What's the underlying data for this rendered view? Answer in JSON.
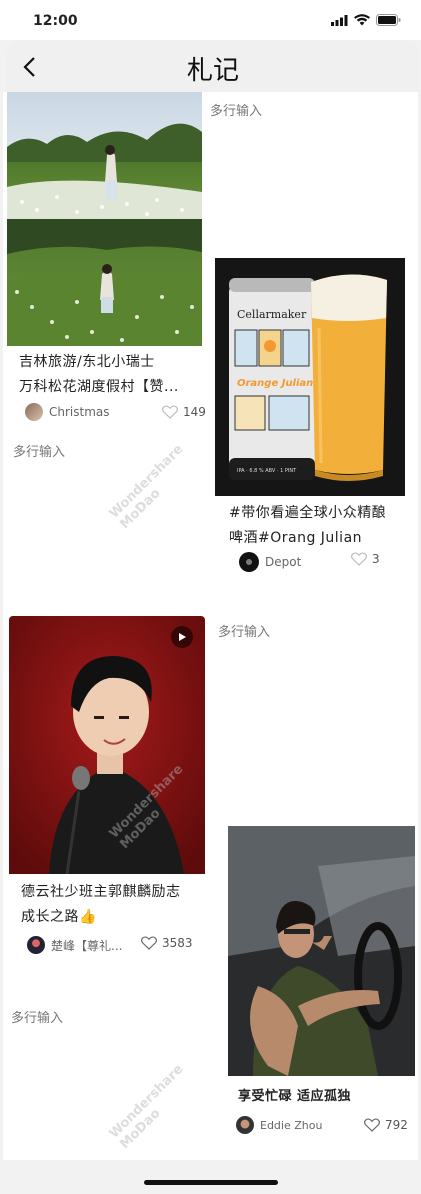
{
  "status": {
    "time": "12:00"
  },
  "nav": {
    "title": "札记"
  },
  "multi_labels": [
    "多行输入",
    "多行输入",
    "多行输入",
    "多行输入"
  ],
  "cards": [
    {
      "title_line1": "吉林旅游/东北小瑞士",
      "title_line2": "万科松花湖度假村【赞...",
      "author": "Christmas",
      "likes": "149"
    },
    {
      "title_line1": "#带你看遍全球小众精酿",
      "title_line2": "啤酒#Orang Julian",
      "author": "Depot",
      "likes": "3"
    },
    {
      "title_line1": "德云社少班主郭麒麟励志",
      "title_line2": "成长之路👍",
      "author": "楚峰【尊礼...",
      "likes": "3583"
    },
    {
      "title_line1": "享受忙碌 适应孤独",
      "author": "Eddie Zhou",
      "likes": "792"
    }
  ],
  "beer": {
    "brand": "Cellarmaker",
    "flavor": "Orange Julian",
    "abv": "IPA · 6.8 % ABV · 1 PINT"
  },
  "watermark": {
    "line1": "Wondershare",
    "line2": "MoDao"
  },
  "icons": {
    "back": "chevron-left-icon",
    "heart": "heart-icon",
    "play": "play-icon",
    "signal": "signal-icon",
    "wifi": "wifi-icon",
    "battery": "battery-icon"
  }
}
